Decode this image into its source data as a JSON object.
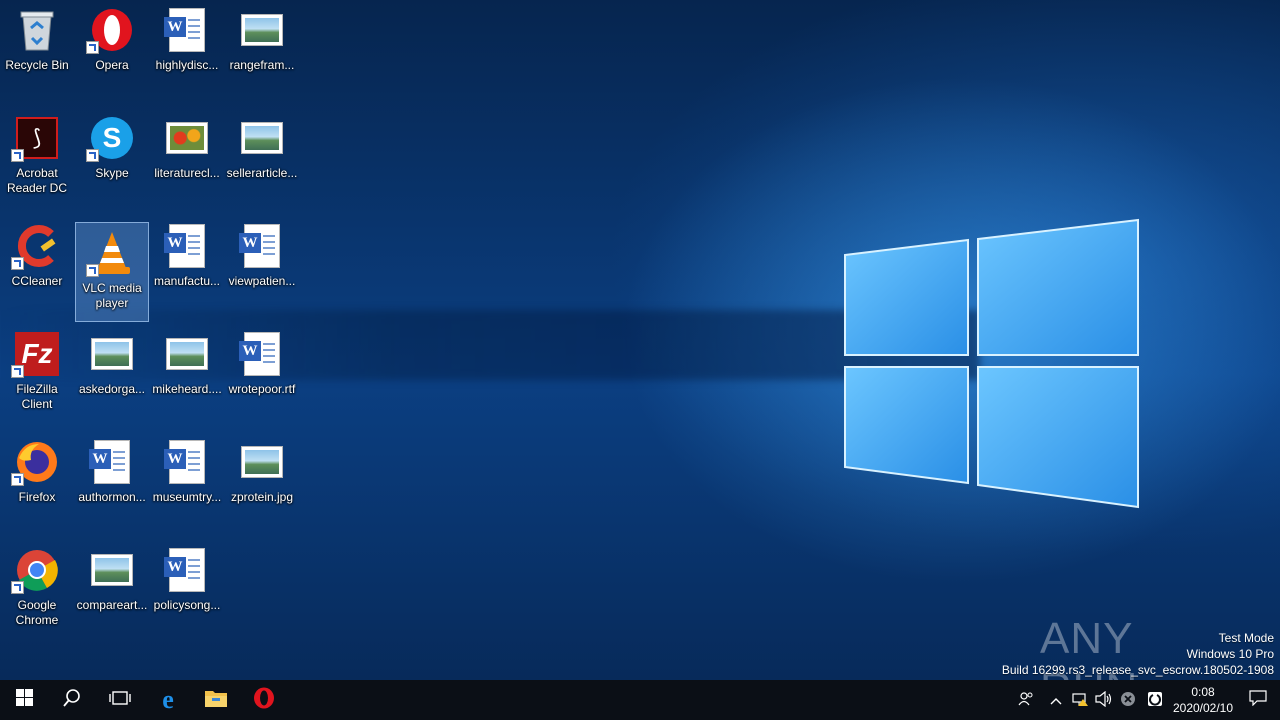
{
  "desktop_icons": [
    {
      "id": "recycle-bin",
      "label": "Recycle Bin"
    },
    {
      "id": "opera",
      "label": "Opera"
    },
    {
      "id": "highlydisc",
      "label": "highlydisc..."
    },
    {
      "id": "rangefram",
      "label": "rangefram..."
    },
    {
      "id": "acrobat",
      "label": "Acrobat Reader DC"
    },
    {
      "id": "skype",
      "label": "Skype"
    },
    {
      "id": "literaturecl",
      "label": "literaturecl..."
    },
    {
      "id": "sellerarticle",
      "label": "sellerarticle..."
    },
    {
      "id": "ccleaner",
      "label": "CCleaner"
    },
    {
      "id": "vlc",
      "label": "VLC media player"
    },
    {
      "id": "manufactu",
      "label": "manufactu..."
    },
    {
      "id": "viewpatien",
      "label": "viewpatien..."
    },
    {
      "id": "filezilla",
      "label": "FileZilla Client"
    },
    {
      "id": "askedorga",
      "label": "askedorga..."
    },
    {
      "id": "mikeheard",
      "label": "mikeheard...."
    },
    {
      "id": "wrotepoor",
      "label": "wrotepoor.rtf"
    },
    {
      "id": "firefox",
      "label": "Firefox"
    },
    {
      "id": "authormon",
      "label": "authormon..."
    },
    {
      "id": "museumtry",
      "label": "museumtry..."
    },
    {
      "id": "zprotein",
      "label": "zprotein.jpg"
    },
    {
      "id": "chrome",
      "label": "Google Chrome"
    },
    {
      "id": "compareart",
      "label": "compareart..."
    },
    {
      "id": "policysong",
      "label": "policysong..."
    }
  ],
  "watermark": {
    "line1": "Test Mode",
    "line2": "Windows 10 Pro",
    "line3": "Build 16299.rs3_release_svc_escrow.180502-1908"
  },
  "anyrun_logo": "ANY RUN",
  "taskbar": {
    "clock_time": "0:08",
    "clock_date": "2020/02/10"
  },
  "colors": {
    "taskbar": "#0b0f16",
    "accent": "#2b8ce6"
  }
}
